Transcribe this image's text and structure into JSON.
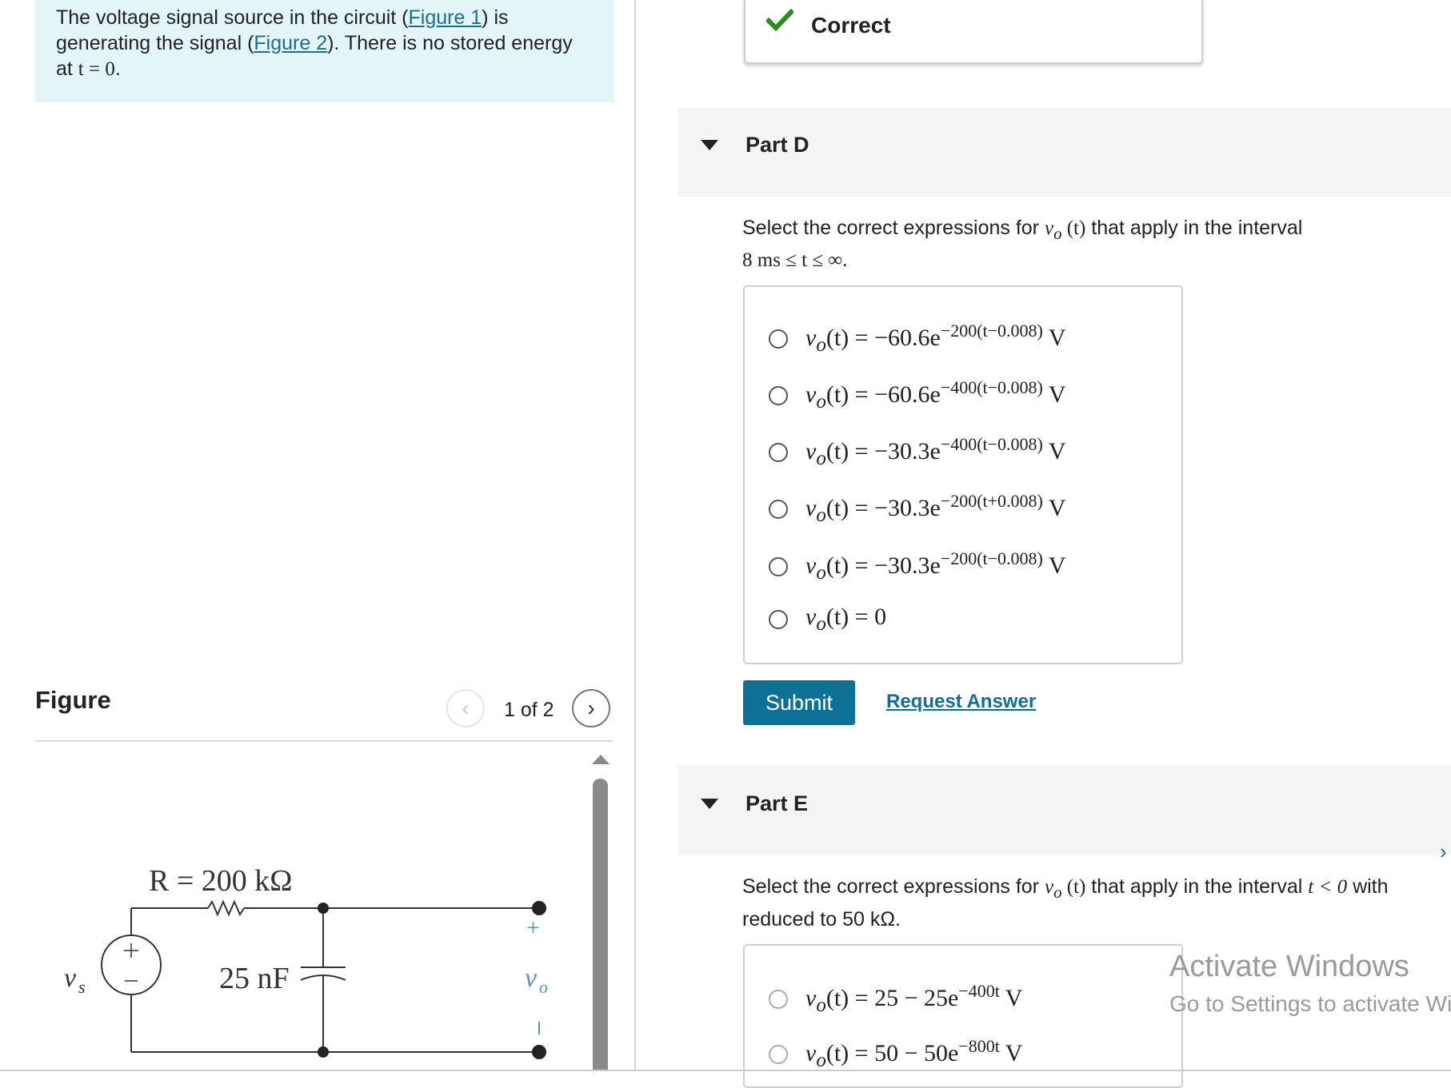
{
  "intro": {
    "text_1": "The voltage signal source in the circuit (",
    "link_1": "Figure 1",
    "text_2": ") is generating the signal (",
    "link_2": "Figure 2",
    "text_3": "). There is no stored energy at ",
    "math": "t = 0",
    "text_4": "."
  },
  "figure": {
    "title": "Figure",
    "page_indicator": "1 of 2",
    "circuit": {
      "resistor_label": "R = 200 kΩ",
      "capacitor_label": "25 nF",
      "source_label": "v",
      "source_subscript": "s",
      "output_label": "v",
      "output_subscript": "o",
      "plus": "+",
      "minus": "−"
    }
  },
  "status": {
    "correct_label": "Correct",
    "check_color": "#2e8b1f"
  },
  "partD": {
    "title": "Part D",
    "question_prefix": "Select the correct expressions for ",
    "question_var": "v",
    "question_sub": "o",
    "question_arg": " (t)",
    "question_mid": " that apply in the interval",
    "question_line2": "8 ms ≤ t ≤ ∞.",
    "options": [
      {
        "lhs": "v",
        "sub": "o",
        "arg": "(t) = −60.6e",
        "exp": "−200(t−0.008)",
        "unit": " V"
      },
      {
        "lhs": "v",
        "sub": "o",
        "arg": "(t) = −60.6e",
        "exp": "−400(t−0.008)",
        "unit": " V"
      },
      {
        "lhs": "v",
        "sub": "o",
        "arg": "(t) = −30.3e",
        "exp": "−400(t−0.008)",
        "unit": " V"
      },
      {
        "lhs": "v",
        "sub": "o",
        "arg": "(t) = −30.3e",
        "exp": "−200(t+0.008)",
        "unit": " V"
      },
      {
        "lhs": "v",
        "sub": "o",
        "arg": "(t) = −30.3e",
        "exp": "−200(t−0.008)",
        "unit": " V"
      },
      {
        "lhs": "v",
        "sub": "o",
        "arg": "(t) = 0",
        "exp": "",
        "unit": ""
      }
    ],
    "submit_label": "Submit",
    "request_answer_label": "Request Answer"
  },
  "partE": {
    "title": "Part E",
    "question_prefix": "Select the correct expressions for ",
    "question_var": "v",
    "question_sub": "o",
    "question_arg": " (t)",
    "question_mid": " that apply in the interval ",
    "question_cond": "t < 0",
    "question_end": " with",
    "question_line2": "reduced to 50 kΩ.",
    "options": [
      {
        "lhs": "v",
        "sub": "o",
        "arg": "(t) = 25 − 25e",
        "exp": "−400t",
        "unit": " V"
      },
      {
        "lhs": "v",
        "sub": "o",
        "arg": "(t) = 50 − 50e",
        "exp": "−800t",
        "unit": " V"
      }
    ]
  },
  "watermark": {
    "title": "Activate Windows",
    "subtitle": "Go to Settings to activate Windows."
  }
}
